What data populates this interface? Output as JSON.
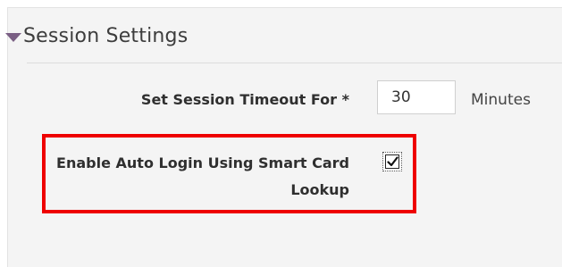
{
  "section": {
    "title": "Session Settings",
    "expanded": true
  },
  "session_timeout": {
    "label": "Set Session Timeout For *",
    "value": "30",
    "unit": "Minutes"
  },
  "auto_login": {
    "label": "Enable Auto Login Using Smart Card Lookup",
    "checked": true
  },
  "colors": {
    "caret": "#7a5f84",
    "highlight_border": "#ee0000",
    "panel_background": "#f4f4f4"
  }
}
